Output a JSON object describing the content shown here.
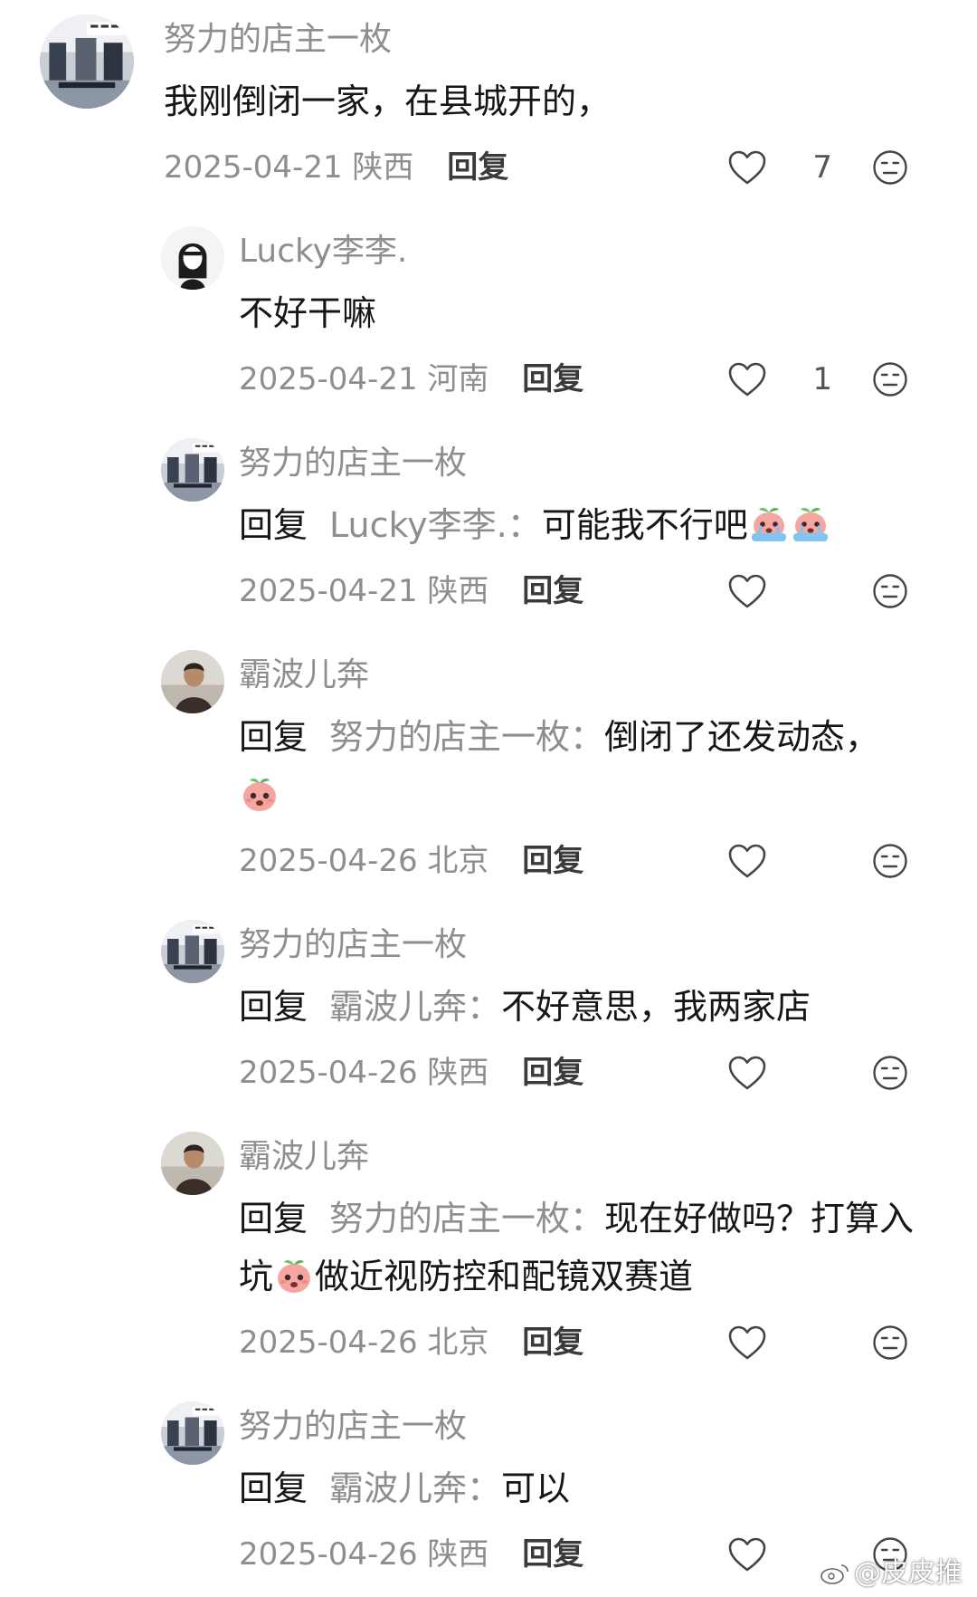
{
  "comments": [
    {
      "username": "努力的店主一枚",
      "text": "我刚倒闭一家，在县城开的，",
      "date": "2025-04-21",
      "location": "陕西",
      "reply_label": "回复",
      "likes": "7"
    },
    {
      "username": "Lucky李李.",
      "text": "不好干嘛",
      "date": "2025-04-21",
      "location": "河南",
      "reply_label": "回复",
      "likes": "1"
    },
    {
      "username": "努力的店主一枚",
      "reply_word": "回复",
      "mention": "Lucky李李.：",
      "text": "可能我不行吧",
      "date": "2025-04-21",
      "location": "陕西",
      "reply_label": "回复"
    },
    {
      "username": "霸波儿奔",
      "reply_word": "回复",
      "mention": "努力的店主一枚：",
      "text": "倒闭了还发动态，",
      "date": "2025-04-26",
      "location": "北京",
      "reply_label": "回复"
    },
    {
      "username": "努力的店主一枚",
      "reply_word": "回复",
      "mention": "霸波儿奔：",
      "text": "不好意思，我两家店",
      "date": "2025-04-26",
      "location": "陕西",
      "reply_label": "回复"
    },
    {
      "username": "霸波儿奔",
      "reply_word": "回复",
      "mention": "努力的店主一枚：",
      "text_part1": "现在好做吗？打算入坑",
      "text_part2": "做近视防控和配镜双赛道",
      "date": "2025-04-26",
      "location": "北京",
      "reply_label": "回复"
    },
    {
      "username": "努力的店主一枚",
      "reply_word": "回复",
      "mention": "霸波儿奔：",
      "text": "可以",
      "date": "2025-04-26",
      "location": "陕西",
      "reply_label": "回复"
    }
  ],
  "watermark": "@皮皮推",
  "icons": {
    "like": "heart-outline-icon",
    "react": "neutral-face-icon",
    "emoji": "peach-sticker-icon"
  }
}
